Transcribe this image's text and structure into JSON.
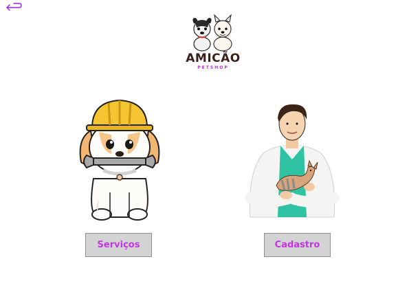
{
  "header": {
    "back_icon": "back-arrow-icon",
    "accent_color": "#a020f0"
  },
  "logo": {
    "title": "AMICÃO",
    "subtitle": "PETSHOP"
  },
  "options": [
    {
      "label": "Serviços",
      "illustration": "dog-with-hardhat-and-wrench"
    },
    {
      "label": "Cadastro",
      "illustration": "veterinarian-holding-puppy"
    }
  ],
  "colors": {
    "button_bg": "#d3d3d3",
    "button_text": "#c433e6",
    "logo_text": "#3a1f1a",
    "logo_sub": "#b42fd6"
  }
}
